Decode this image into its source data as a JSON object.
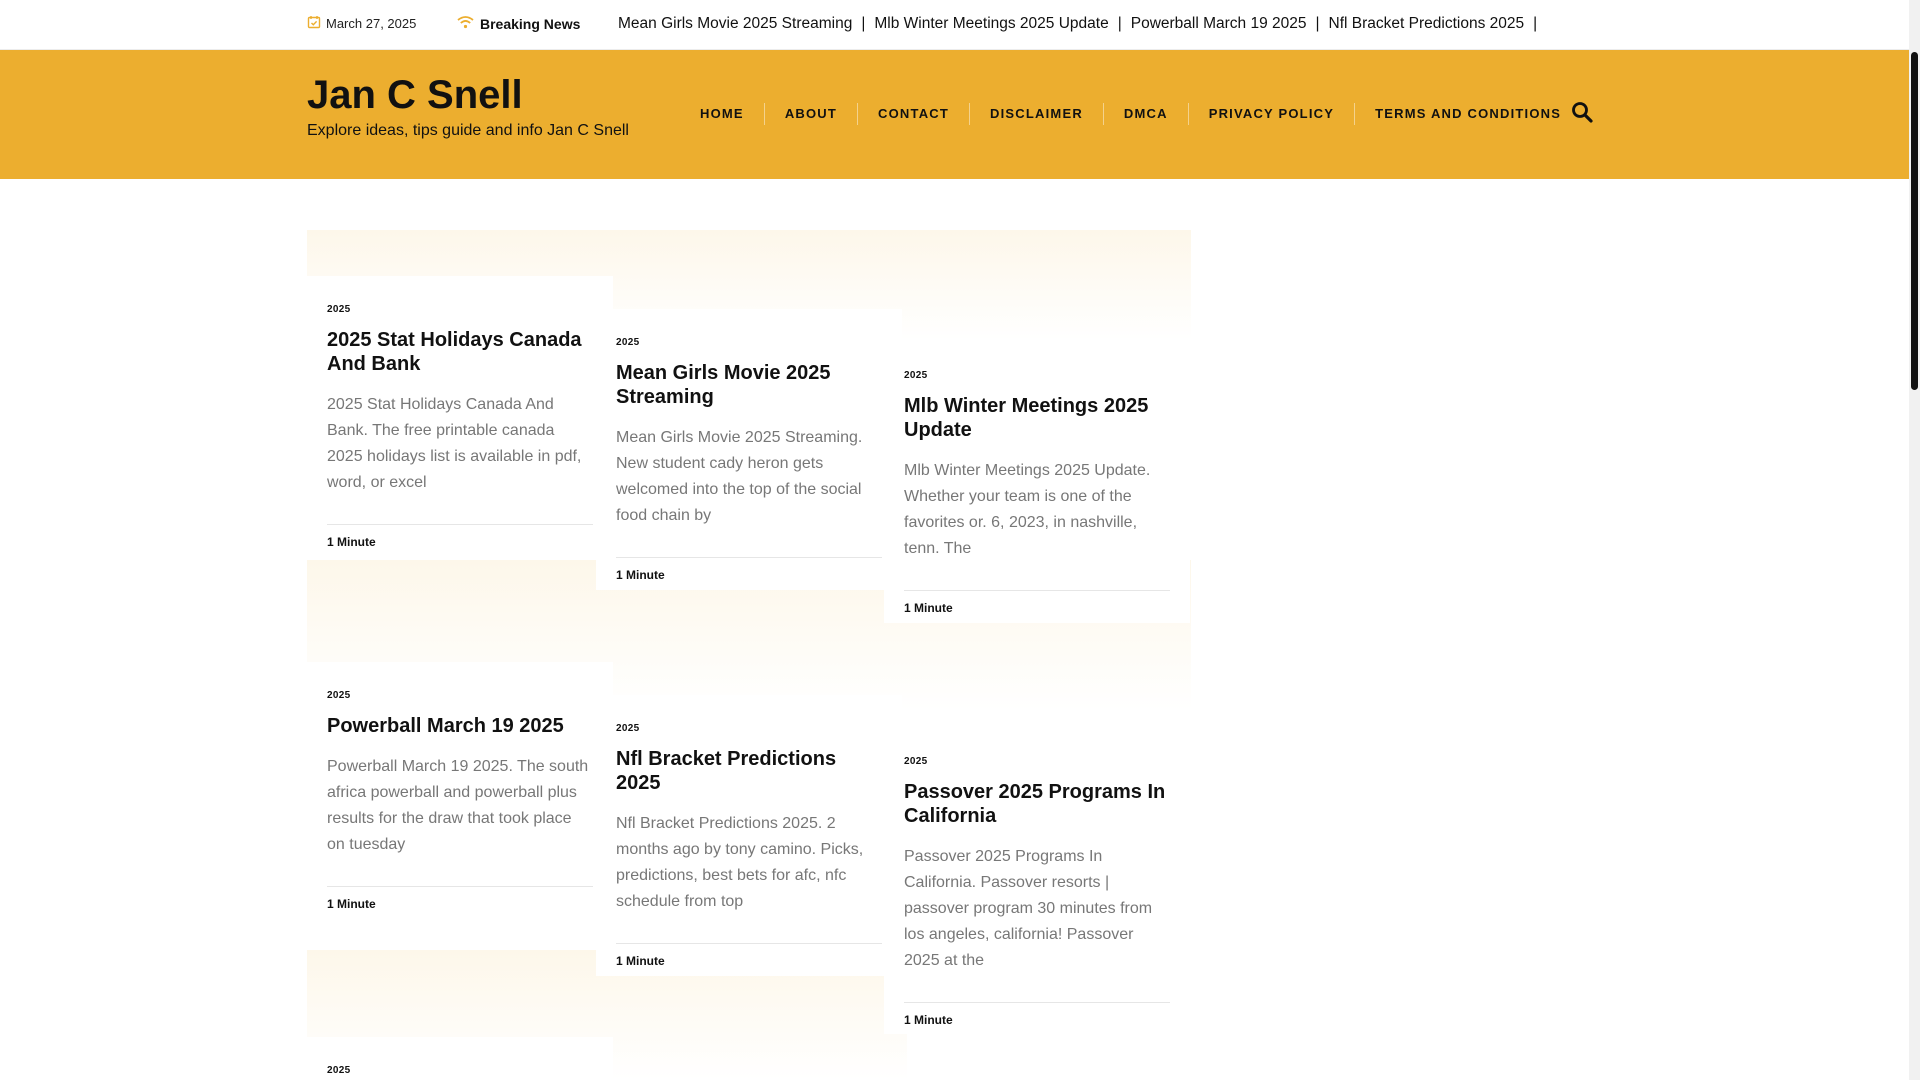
{
  "topbar": {
    "date": "March 27, 2025",
    "breaking_label": "Breaking News",
    "ticker": [
      "Mean Girls Movie 2025 Streaming",
      "Mlb Winter Meetings 2025 Update",
      "Powerball March 19 2025",
      "Nfl Bracket Predictions 2025"
    ],
    "separator": "|",
    "icons": {
      "date": "calendar-check-icon",
      "breaking": "wifi-icon"
    },
    "icon_color": "#ecae2f"
  },
  "header": {
    "site_title": "Jan C Snell",
    "tagline": "Explore ideas, tips guide and info Jan C Snell",
    "bg_color": "#ecae2f",
    "nav": [
      "HOME",
      "ABOUT",
      "CONTACT",
      "DISCLAIMER",
      "DMCA",
      "PRIVACY POLICY",
      "TERMS AND CONDITIONS"
    ],
    "search_icon": "search-icon"
  },
  "posts": [
    {
      "category": "2025",
      "title": "2025 Stat Holidays Canada And Bank",
      "excerpt": "2025 Stat Holidays Canada And Bank. The free printable canada 2025 holidays list is available in pdf, word, or excel",
      "read_time": "1 Minute"
    },
    {
      "category": "2025",
      "title": "Mean Girls Movie 2025 Streaming",
      "excerpt": "Mean Girls Movie 2025 Streaming. New student cady heron gets welcomed into the top of the social food chain by",
      "read_time": "1 Minute"
    },
    {
      "category": "2025",
      "title": "Mlb Winter Meetings 2025 Update",
      "excerpt": "Mlb Winter Meetings 2025 Update. Whether your team is one of the favorites or. 6, 2023, in nashville, tenn. The",
      "read_time": "1 Minute"
    },
    {
      "category": "2025",
      "title": "Powerball March 19 2025",
      "excerpt": "Powerball March 19 2025. The south africa powerball and powerball plus results for the draw that took place on tuesday",
      "read_time": "1 Minute"
    },
    {
      "category": "2025",
      "title": "Nfl Bracket Predictions 2025",
      "excerpt": "Nfl Bracket Predictions 2025. 2 months ago by tony camino. Picks, predictions, best bets for afc, nfc schedule from top",
      "read_time": "1 Minute"
    },
    {
      "category": "2025",
      "title": "Passover 2025 Programs In California",
      "excerpt": "Passover 2025 Programs In California. Passover resorts | passover program 30 minutes from los angeles, california! Passover 2025 at the",
      "read_time": "1 Minute"
    },
    {
      "category": "2025"
    }
  ]
}
